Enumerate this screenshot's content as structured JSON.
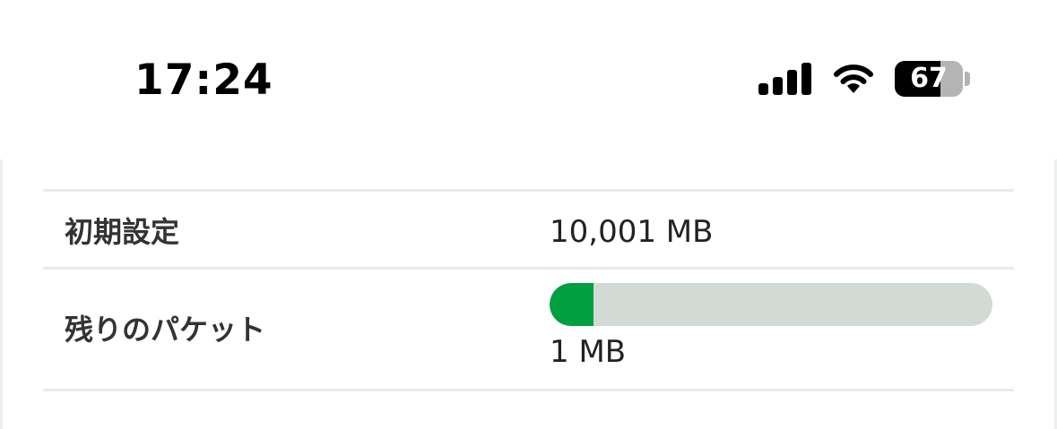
{
  "status_bar": {
    "time": "17:24",
    "signal_icon": "cellular-signal-icon",
    "wifi_icon": "wifi-icon",
    "battery_level": 67,
    "battery_text": "67"
  },
  "plan": {
    "initial_label": "初期設定",
    "initial_value": "10,001 MB",
    "remaining_label": "残りのパケット",
    "remaining_value": "1 MB",
    "remaining_fraction": 0.1
  },
  "colors": {
    "progress_fill": "#00a040",
    "progress_track": "#d2dad6"
  }
}
